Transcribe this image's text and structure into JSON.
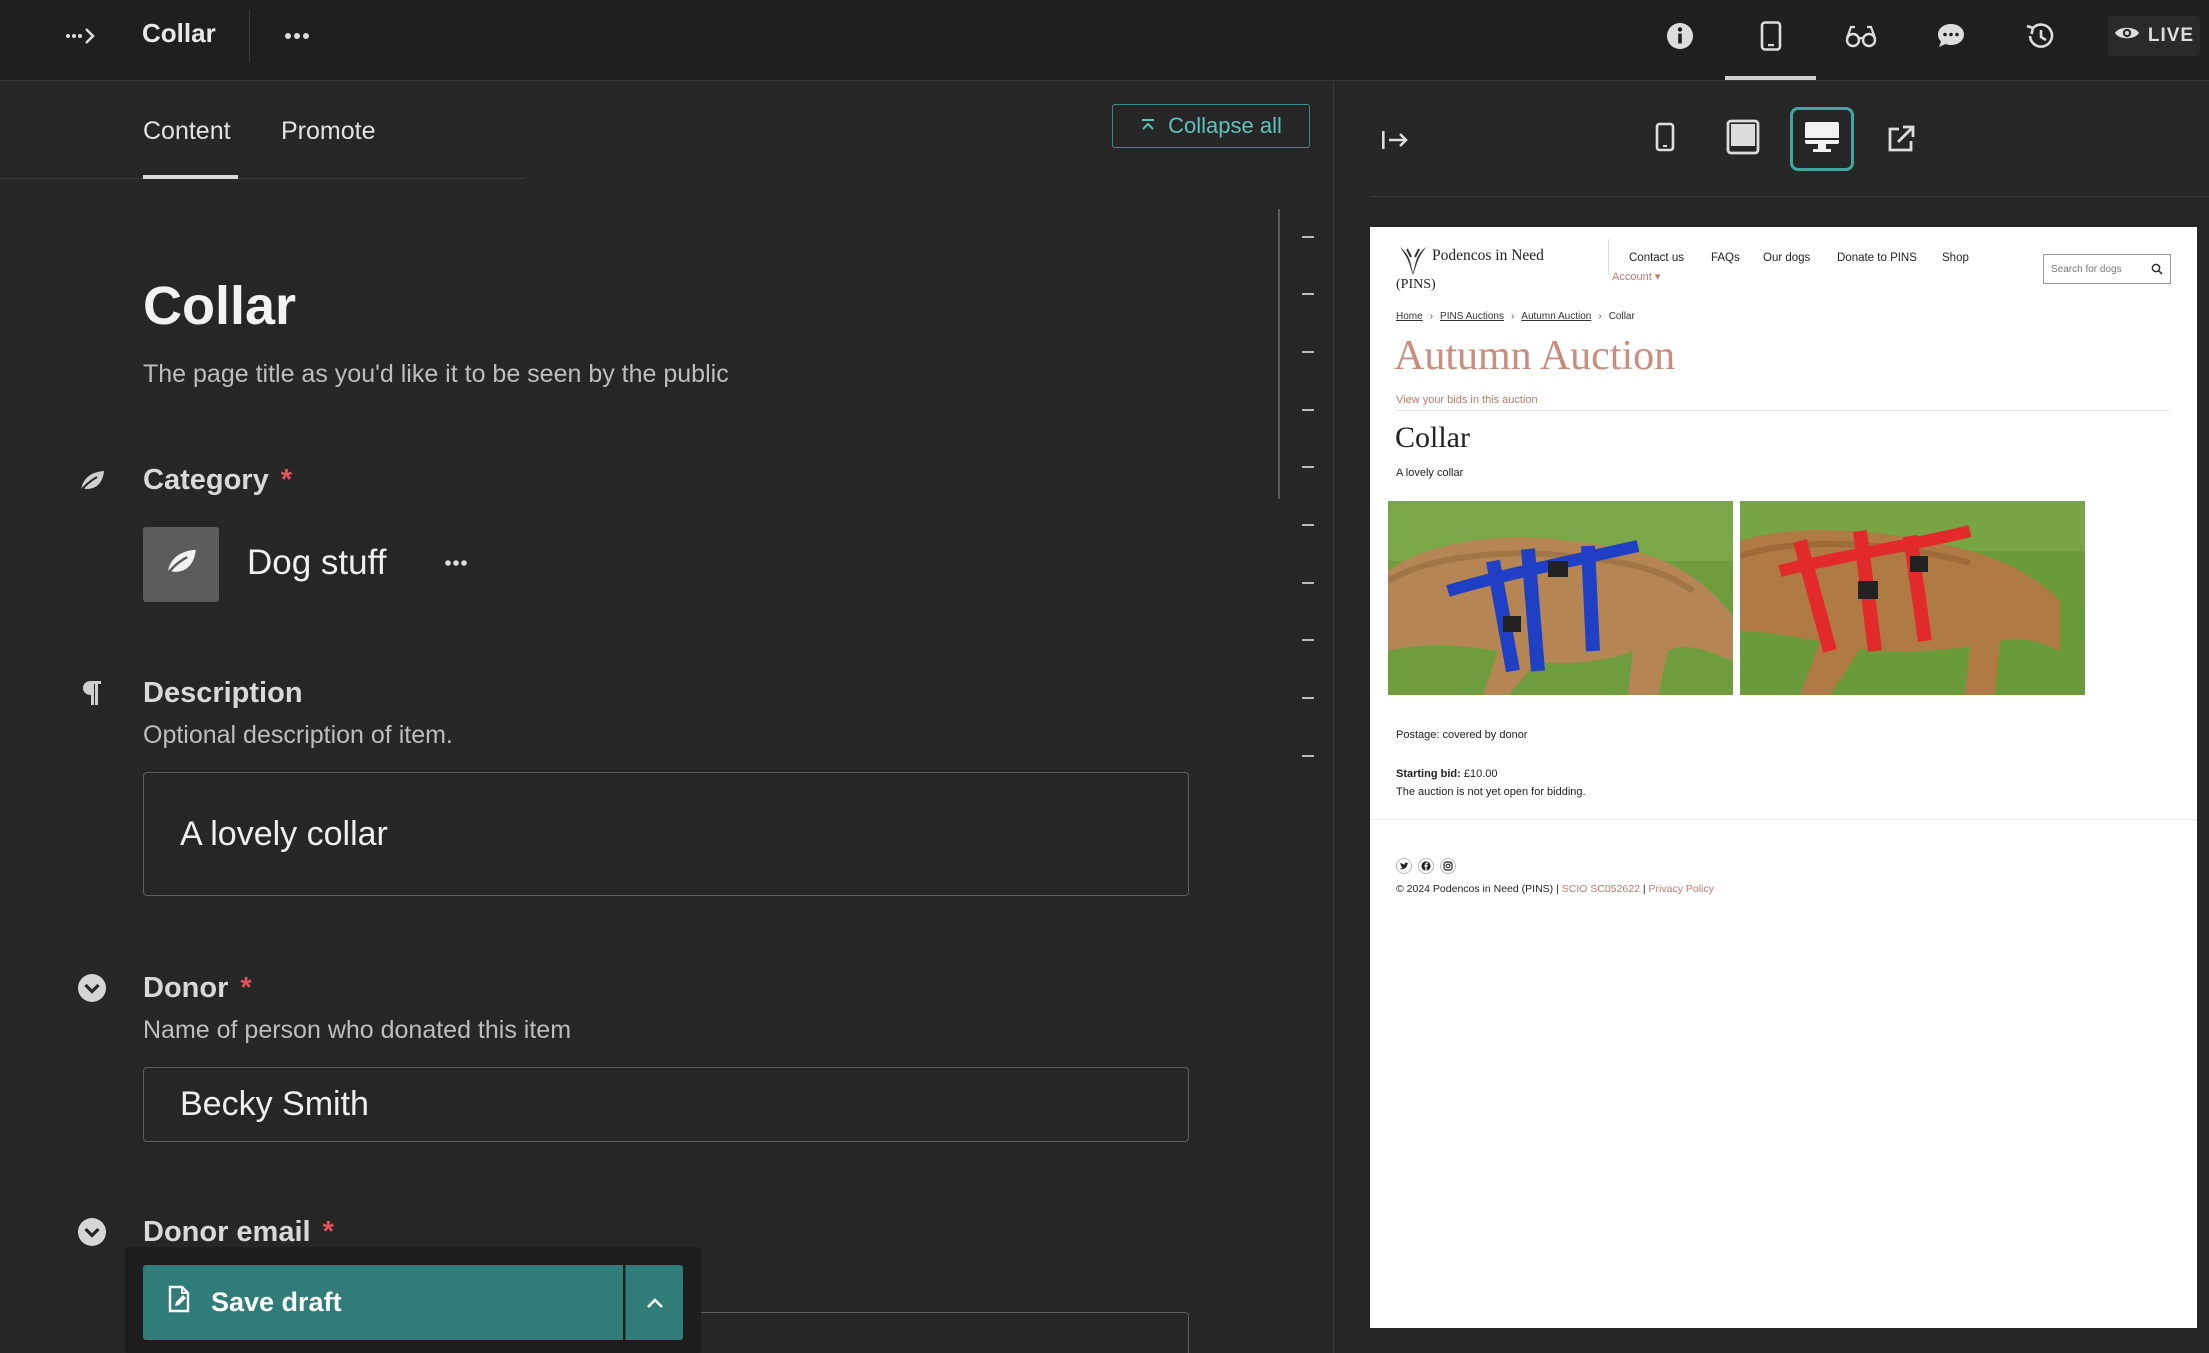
{
  "topbar": {
    "back_icon": "breadcrumb-expand-icon",
    "title": "Collar",
    "more_icon": "ellipsis-icon",
    "live_label": "LIVE",
    "icons": [
      "info-icon",
      "mobile-preview-icon",
      "glasses-icon",
      "comments-icon",
      "history-icon",
      "eye-icon"
    ]
  },
  "tabs": {
    "content": "Content",
    "promote": "Promote"
  },
  "collapse_all_label": "Collapse all",
  "title_field": {
    "value": "Collar",
    "help": "The page title as you'd like it to be seen by the public"
  },
  "category": {
    "label": "Category",
    "required_mark": "*",
    "value": "Dog stuff",
    "icon": "leaf-icon"
  },
  "description": {
    "label": "Description",
    "help": "Optional description of item.",
    "value": "A lovely collar",
    "icon": "pilcrow-icon"
  },
  "donor": {
    "label": "Donor",
    "required_mark": "*",
    "help": "Name of person who donated this item",
    "value": "Becky Smith",
    "icon": "collapse-circle-icon"
  },
  "donor_email": {
    "label": "Donor email",
    "required_mark": "*",
    "icon": "collapse-circle-icon"
  },
  "save": {
    "label": "Save draft",
    "icon": "doc-edit-icon",
    "toggle_icon": "chevron-up-icon"
  },
  "preview": {
    "active_device": "desktop",
    "accent_color": "#3fa7a0",
    "site": {
      "brand_line1": "Podencos in Need",
      "brand_line2": "(PINS)",
      "nav": {
        "contact": "Contact us",
        "faqs": "FAQs",
        "dogs": "Our dogs",
        "donate": "Donate to PINS",
        "shop": "Shop",
        "account": "Account"
      },
      "search_placeholder": "Search for dogs",
      "breadcrumb": [
        "Home",
        "PINS Auctions",
        "Autumn Auction",
        "Collar"
      ],
      "heading": "Autumn Auction",
      "bids_link": "View your bids in this auction",
      "item_title": "Collar",
      "item_desc": "A lovely collar",
      "postage": "Postage: covered by donor",
      "starting_bid_label": "Starting bid:",
      "starting_bid_value": "£10.00",
      "not_open": "The auction is not yet open for bidding.",
      "footer_prefix": "© 2024 Podencos in Need (PINS) |",
      "footer_scio": "SCIO SC052622",
      "footer_sep": "|",
      "footer_privacy": "Privacy Policy",
      "accent_color": "#c98c7d"
    }
  }
}
